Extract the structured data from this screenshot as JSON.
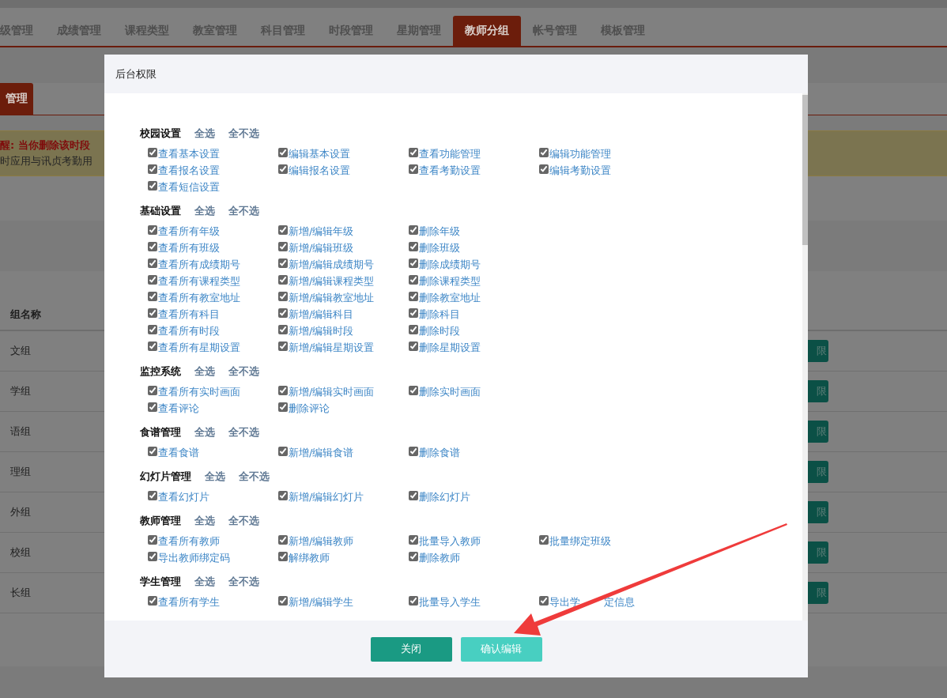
{
  "nav_tabs": [
    {
      "label": "级管理",
      "selected": false
    },
    {
      "label": "成绩管理",
      "selected": false
    },
    {
      "label": "课程类型",
      "selected": false
    },
    {
      "label": "教室管理",
      "selected": false
    },
    {
      "label": "科目管理",
      "selected": false
    },
    {
      "label": "时段管理",
      "selected": false
    },
    {
      "label": "星期管理",
      "selected": false
    },
    {
      "label": "教师分组",
      "selected": true
    },
    {
      "label": "帐号管理",
      "selected": false
    },
    {
      "label": "模板管理",
      "selected": false
    }
  ],
  "sub_tabs": [
    {
      "label": "管理",
      "selected": true
    }
  ],
  "alert": {
    "warning": "醒: 当你删除该时段",
    "note": "时应用与讯贞考勤用"
  },
  "table": {
    "columns": [
      "组名称"
    ],
    "rows": [
      {
        "name": "文组",
        "action": "限"
      },
      {
        "name": "学组",
        "action": "限"
      },
      {
        "name": "语组",
        "action": "限"
      },
      {
        "name": "理组",
        "action": "限"
      },
      {
        "name": "外组",
        "action": "限"
      },
      {
        "name": "校组",
        "action": "限"
      },
      {
        "name": "长组",
        "action": "限"
      }
    ]
  },
  "modal": {
    "title": "后台权限",
    "sections": [
      {
        "title": "校园设置",
        "select_all": "全选",
        "select_none": "全不选",
        "items": [
          {
            "label": "查看基本设置",
            "checked": true
          },
          {
            "label": "编辑基本设置",
            "checked": true
          },
          {
            "label": "查看功能管理",
            "checked": true
          },
          {
            "label": "编辑功能管理",
            "checked": true
          },
          {
            "label": "查看报名设置",
            "checked": true
          },
          {
            "label": "编辑报名设置",
            "checked": true
          },
          {
            "label": "查看考勤设置",
            "checked": true
          },
          {
            "label": "编辑考勤设置",
            "checked": true
          },
          {
            "label": "查看短信设置",
            "checked": true
          }
        ]
      },
      {
        "title": "基础设置",
        "select_all": "全选",
        "select_none": "全不选",
        "kind": "triple",
        "items": [
          {
            "label": "查看所有年级",
            "checked": true
          },
          {
            "label": "新增/编辑年级",
            "checked": true
          },
          {
            "label": "删除年级",
            "checked": true
          },
          {
            "label": "查看所有班级",
            "checked": true
          },
          {
            "label": "新增/编辑班级",
            "checked": true
          },
          {
            "label": "删除班级",
            "checked": true
          },
          {
            "label": "查看所有成绩期号",
            "checked": true
          },
          {
            "label": "新增/编辑成绩期号",
            "checked": true
          },
          {
            "label": "删除成绩期号",
            "checked": true
          },
          {
            "label": "查看所有课程类型",
            "checked": true
          },
          {
            "label": "新增/编辑课程类型",
            "checked": true
          },
          {
            "label": "删除课程类型",
            "checked": true
          },
          {
            "label": "查看所有教室地址",
            "checked": true
          },
          {
            "label": "新增/编辑教室地址",
            "checked": true
          },
          {
            "label": "删除教室地址",
            "checked": true
          },
          {
            "label": "查看所有科目",
            "checked": true
          },
          {
            "label": "新增/编辑科目",
            "checked": true
          },
          {
            "label": "删除科目",
            "checked": true
          },
          {
            "label": "查看所有时段",
            "checked": true
          },
          {
            "label": "新增/编辑时段",
            "checked": true
          },
          {
            "label": "删除时段",
            "checked": true
          },
          {
            "label": "查看所有星期设置",
            "checked": true
          },
          {
            "label": "新增/编辑星期设置",
            "checked": true
          },
          {
            "label": "删除星期设置",
            "checked": true
          }
        ]
      },
      {
        "title": "监控系统",
        "select_all": "全选",
        "select_none": "全不选",
        "kind": "triple",
        "items": [
          {
            "label": "查看所有实时画面",
            "checked": true
          },
          {
            "label": "新增/编辑实时画面",
            "checked": true
          },
          {
            "label": "删除实时画面",
            "checked": true
          },
          {
            "label": "查看评论",
            "checked": true
          },
          {
            "label": "删除评论",
            "checked": true
          }
        ]
      },
      {
        "title": "食谱管理",
        "select_all": "全选",
        "select_none": "全不选",
        "kind": "triple",
        "items": [
          {
            "label": "查看食谱",
            "checked": true
          },
          {
            "label": "新增/编辑食谱",
            "checked": true
          },
          {
            "label": "删除食谱",
            "checked": true
          }
        ]
      },
      {
        "title": "幻灯片管理",
        "select_all": "全选",
        "select_none": "全不选",
        "kind": "triple",
        "items": [
          {
            "label": "查看幻灯片",
            "checked": true
          },
          {
            "label": "新增/编辑幻灯片",
            "checked": true
          },
          {
            "label": "删除幻灯片",
            "checked": true
          }
        ]
      },
      {
        "title": "教师管理",
        "select_all": "全选",
        "select_none": "全不选",
        "items": [
          {
            "label": "查看所有教师",
            "checked": true
          },
          {
            "label": "新增/编辑教师",
            "checked": true
          },
          {
            "label": "批量导入教师",
            "checked": true
          },
          {
            "label": "批量绑定班级",
            "checked": true
          },
          {
            "label": "导出教师绑定码",
            "checked": true
          },
          {
            "label": "解绑教师",
            "checked": true
          },
          {
            "label": "删除教师",
            "checked": true
          }
        ]
      },
      {
        "title": "学生管理",
        "select_all": "全选",
        "select_none": "全不选",
        "items": [
          {
            "label": "查看所有学生",
            "checked": true
          },
          {
            "label": "新增/编辑学生",
            "checked": true
          },
          {
            "label": "批量导入学生",
            "checked": true
          },
          {
            "label": "导出学",
            "label_end": "定信息",
            "checked": true
          }
        ]
      }
    ],
    "buttons": [
      {
        "label": "关闭",
        "kind": "close"
      },
      {
        "label": "确认编辑",
        "kind": "confirm"
      }
    ]
  }
}
